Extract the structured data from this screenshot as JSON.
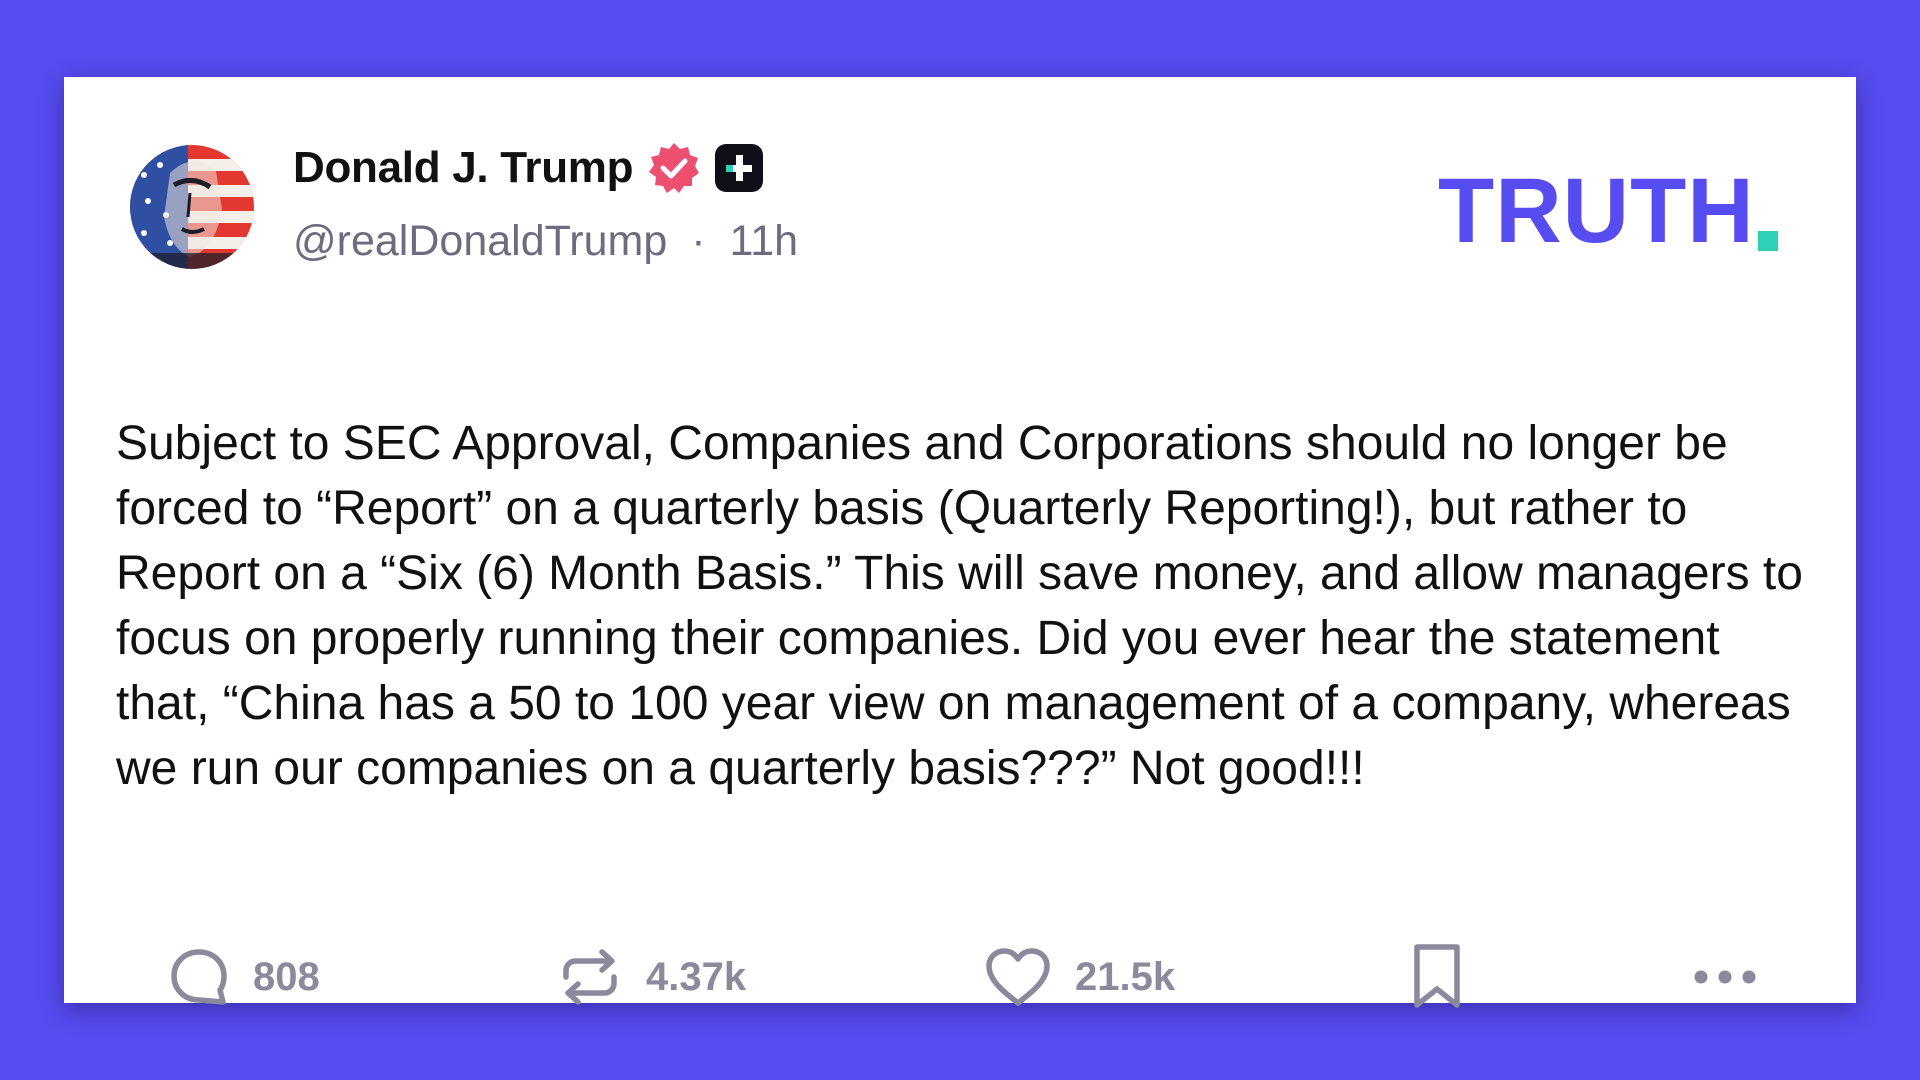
{
  "post": {
    "display_name": "Donald J. Trump",
    "handle": "@realDonaldTrump",
    "separator": "·",
    "timestamp": "11h",
    "body": "Subject to SEC Approval, Companies and Corporations should no longer be forced to “Report” on a quarterly basis (Quarterly Reporting!), but rather to Report on a “Six (6) Month Basis.” This will save money, and allow managers to focus on properly running their companies. Did you ever hear the statement that, “China has a 50 to 100 year view on management of a company, whereas we run our companies on a quarterly basis???” Not good!!!"
  },
  "logo": {
    "text": "TRUTH",
    "color": "#574cef",
    "dot_color": "#2fd1b5"
  },
  "actions": {
    "replies": {
      "icon": "comment-icon",
      "count": "808"
    },
    "retruths": {
      "icon": "retruth-icon",
      "count": "4.37k"
    },
    "likes": {
      "icon": "heart-icon",
      "count": "21.5k"
    },
    "bookmark": {
      "icon": "bookmark-icon"
    },
    "more": {
      "icon": "more-icon"
    }
  },
  "colors": {
    "background": "#574cef",
    "card": "#ffffff",
    "verified_badge": "#ec4f6f",
    "muted_text": "#6d6b80",
    "action_gray": "#8b899c"
  }
}
